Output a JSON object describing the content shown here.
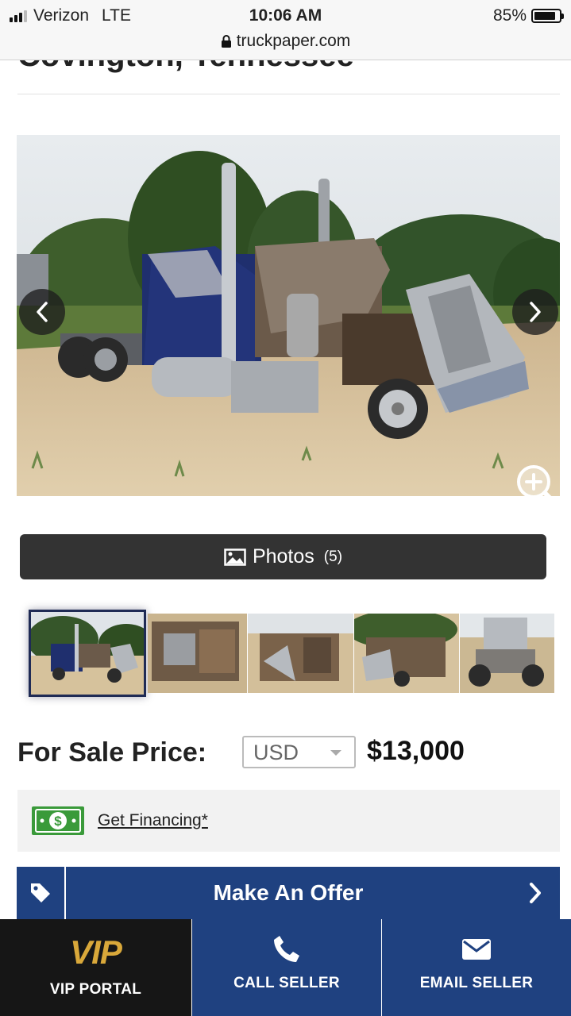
{
  "status_bar": {
    "carrier": "Verizon",
    "network": "LTE",
    "time": "10:06 AM",
    "battery": "85%",
    "battery_level": 0.85,
    "url": "truckpaper.com"
  },
  "listing": {
    "location_title": "Covington, Tennessee"
  },
  "gallery": {
    "photos_label": "Photos",
    "photos_count": "(5)",
    "thumbnail_count": 5,
    "selected_index": 0
  },
  "price": {
    "label": "For Sale Price:",
    "currency": "USD",
    "value": "$13,000"
  },
  "financing": {
    "link": "Get Financing*"
  },
  "offer": {
    "label": "Make An Offer"
  },
  "bottom_bar": {
    "vip_logo": "VIP",
    "vip_label": "VIP PORTAL",
    "call_label": "CALL SELLER",
    "email_label": "EMAIL SELLER"
  },
  "colors": {
    "primary_blue": "#1f4180",
    "dark_button": "#333333",
    "vip_gold": "#d9a83a",
    "money_green": "#3a9a3a"
  },
  "icons": [
    "lock-icon",
    "image-icon",
    "chevron-left-icon",
    "chevron-right-icon",
    "zoom-in-icon",
    "money-icon",
    "tag-icon",
    "phone-icon",
    "envelope-icon"
  ]
}
